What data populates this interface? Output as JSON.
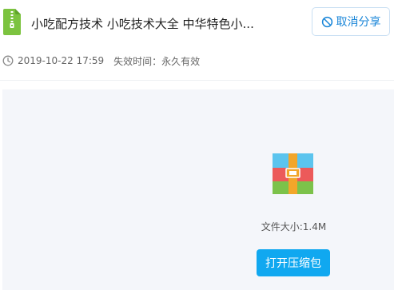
{
  "header": {
    "title": "小吃配方技术 小吃技术大全 中华特色小...",
    "cancel_share_label": "取消分享"
  },
  "meta": {
    "share_time": "2019-10-22 17:59",
    "expire_label": "失效时间：永久有效"
  },
  "file": {
    "size_label": "文件大小:1.4M",
    "open_button_label": "打开压缩包"
  },
  "icons": {
    "file_icon": "zip-file-icon",
    "cancel_icon": "ban-icon",
    "clock_icon": "clock-icon",
    "archive_icon": "archive-package-icon"
  },
  "colors": {
    "accent": "#1a86d8",
    "button_primary": "#10a8f0",
    "panel_bg": "#f4f6fa",
    "file_icon_green": "#7cc33f"
  }
}
